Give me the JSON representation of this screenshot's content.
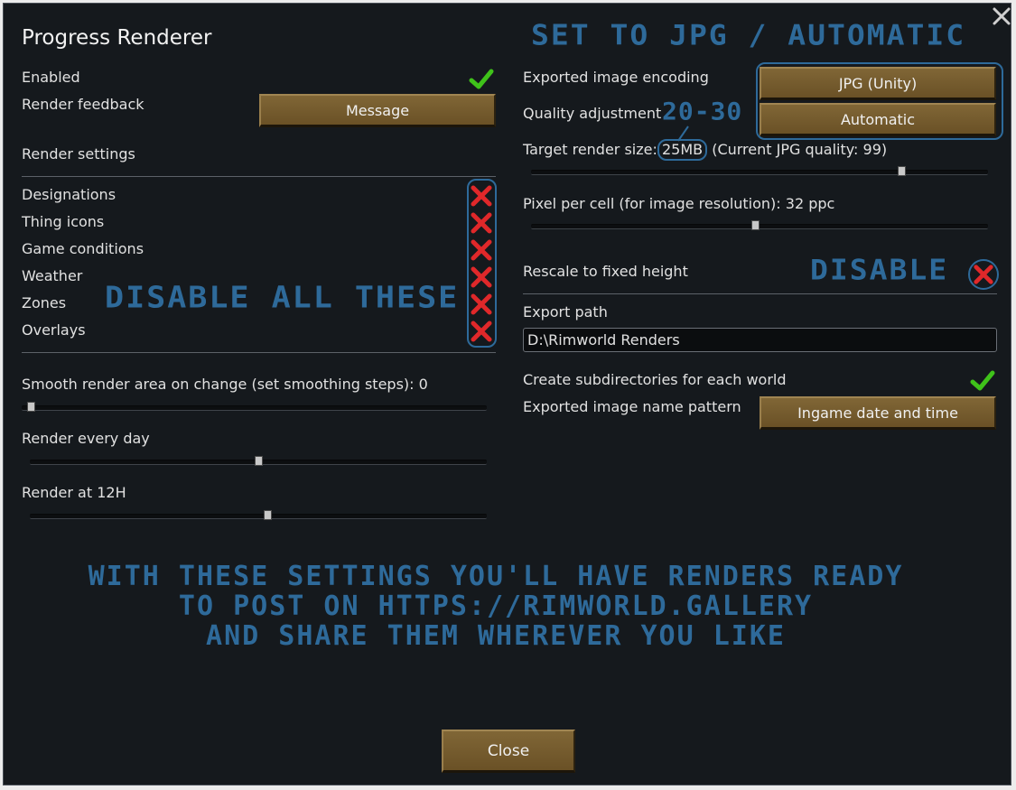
{
  "window": {
    "title": "Progress Renderer",
    "close_label": "Close"
  },
  "left": {
    "enabled_label": "Enabled",
    "render_feedback_label": "Render feedback",
    "render_feedback_value": "Message",
    "render_settings_heading": "Render settings",
    "render_items": [
      "Designations",
      "Thing icons",
      "Game conditions",
      "Weather",
      "Zones",
      "Overlays"
    ],
    "smooth_label": "Smooth render area on change (set smoothing steps): 0",
    "smooth_value": 0,
    "every_label": "Render every day",
    "every_fraction": 0.5,
    "at_label": "Render at 12H",
    "at_fraction": 0.52
  },
  "right": {
    "encoding_label": "Exported image encoding",
    "encoding_value": "JPG (Unity)",
    "quality_label": "Quality adjustment",
    "quality_value": "Automatic",
    "target_label_prefix": "Target render size: ",
    "target_value": "25MB",
    "target_label_suffix": " (Current JPG quality: 99)",
    "target_fraction": 0.81,
    "ppc_label": "Pixel per cell (for image resolution): 32 ppc",
    "ppc_fraction": 0.49,
    "rescale_label": "Rescale to fixed height",
    "export_path_label": "Export path",
    "export_path_value": "D:\\Rimworld Renders",
    "subdir_label": "Create subdirectories for each world",
    "name_pattern_label": "Exported image name pattern",
    "name_pattern_value": "Ingame date and time"
  },
  "annotations": {
    "top": "Set to JPG / Automatic",
    "quality": "20-30",
    "disable_all": "Disable all these",
    "disable": "Disable",
    "bottom": "With these settings you'll have renders ready\nto post on https://rimworld.gallery\nand share them wherever you like"
  },
  "colors": {
    "annotation": "#2e6a9a",
    "check": "#3fc21a",
    "cross": "#e0282a",
    "button": "#7a5f30"
  }
}
